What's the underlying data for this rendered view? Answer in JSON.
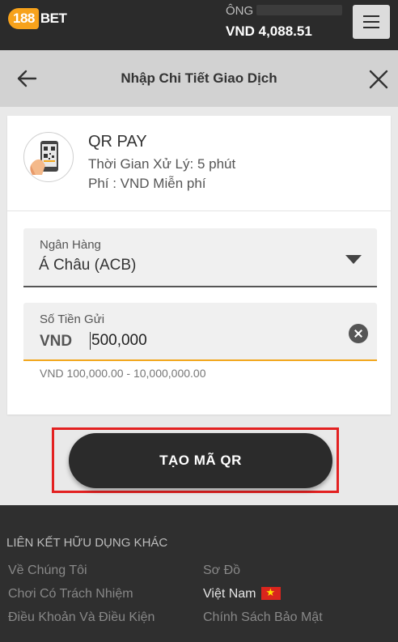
{
  "topbar": {
    "logo_number": "188",
    "logo_word": "BET",
    "account_prefix": "ÔNG",
    "balance": "VND 4,088.51"
  },
  "header": {
    "title": "Nhập Chi Tiết Giao Dịch"
  },
  "method": {
    "name": "QR PAY",
    "processing_time": "Thời Gian Xử Lý: 5 phút",
    "fee": "Phí : VND Miễn phí"
  },
  "bank": {
    "label": "Ngân Hàng",
    "selected": "Á Châu (ACB)"
  },
  "amount": {
    "label": "Số Tiền Gửi",
    "currency": "VND",
    "value": "500,000",
    "range": "VND 100,000.00 - 10,000,000.00"
  },
  "submit": {
    "label": "TẠO MÃ QR"
  },
  "footer": {
    "title": "LIÊN KẾT HỮU DỤNG KHÁC",
    "links": [
      "Về Chúng Tôi",
      "Sơ Đồ",
      "Chơi Có Trách Nhiệm",
      "Việt Nam",
      "Điều Khoản Và Điều Kiện",
      "Chính Sách Bảo Mật"
    ]
  },
  "colors": {
    "accent": "#f2a61c",
    "dark": "#2b2b2b",
    "highlight": "#e32121"
  }
}
